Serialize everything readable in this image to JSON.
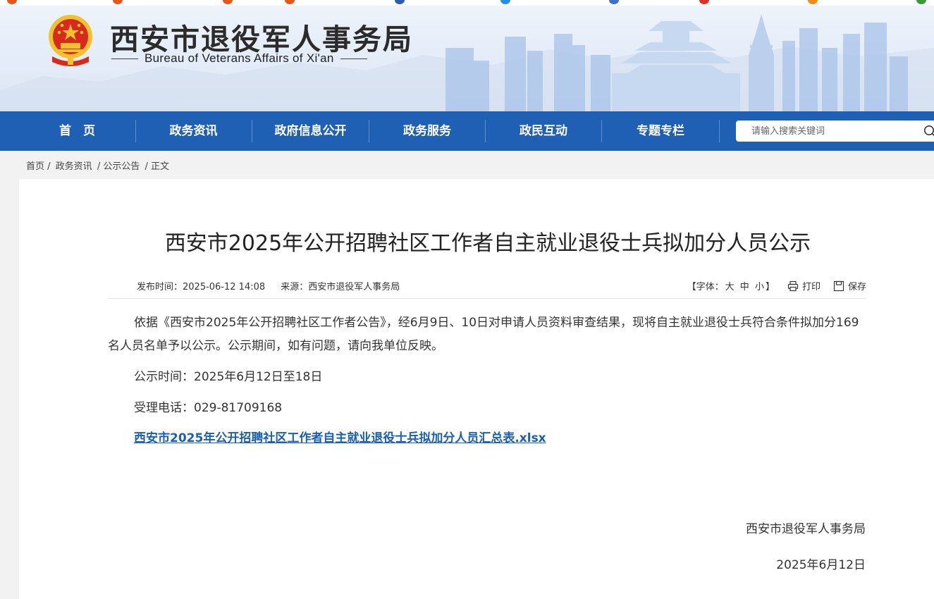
{
  "site": {
    "title": "西安市退役军人事务局",
    "subtitle": "Bureau of Veterans Affairs of Xi'an"
  },
  "nav": {
    "items": [
      "首　页",
      "政务资讯",
      "政府信息公开",
      "政务服务",
      "政民互动",
      "专题专栏"
    ],
    "search_placeholder": "请输入搜索关键词"
  },
  "breadcrumb": [
    "首页 /",
    "政务资讯",
    "/ 公示公告",
    "/  正文"
  ],
  "article": {
    "title": "西安市2025年公开招聘社区工作者自主就业退役士兵拟加分人员公示",
    "publish_time": "发布时间：2025-06-12 14:08",
    "source": "来源：西安市退役军人事务局",
    "font_size_label_open": "【字体：",
    "font_sizes": [
      "大",
      "中",
      "小"
    ],
    "font_size_label_close": "】",
    "print_label": "打印",
    "save_label": "保存",
    "paragraph1": "依据《西安市2025年公开招聘社区工作者公告》，经6月9日、10日对申请人员资料审查结果，现将自主就业退役士兵符合条件拟加分169名人员名单予以公示。公示期间，如有问题，请向我单位反映。",
    "paragraph2": "公示时间：2025年6月12日至18日",
    "paragraph3": "受理电话：029-81709168",
    "attachment": "西安市2025年公开招聘社区工作者自主就业退役士兵拟加分人员汇总表.xlsx",
    "signature": "西安市退役军人事务局",
    "date": "2025年6月12日"
  },
  "colors": {
    "nav_bg": "#1f5fb4",
    "link": "#1a5fb4",
    "emblem_red": "#d62a1e",
    "emblem_gold": "#f2c12e"
  },
  "icons": [
    "national-emblem-icon",
    "search-icon",
    "print-icon",
    "save-icon"
  ]
}
